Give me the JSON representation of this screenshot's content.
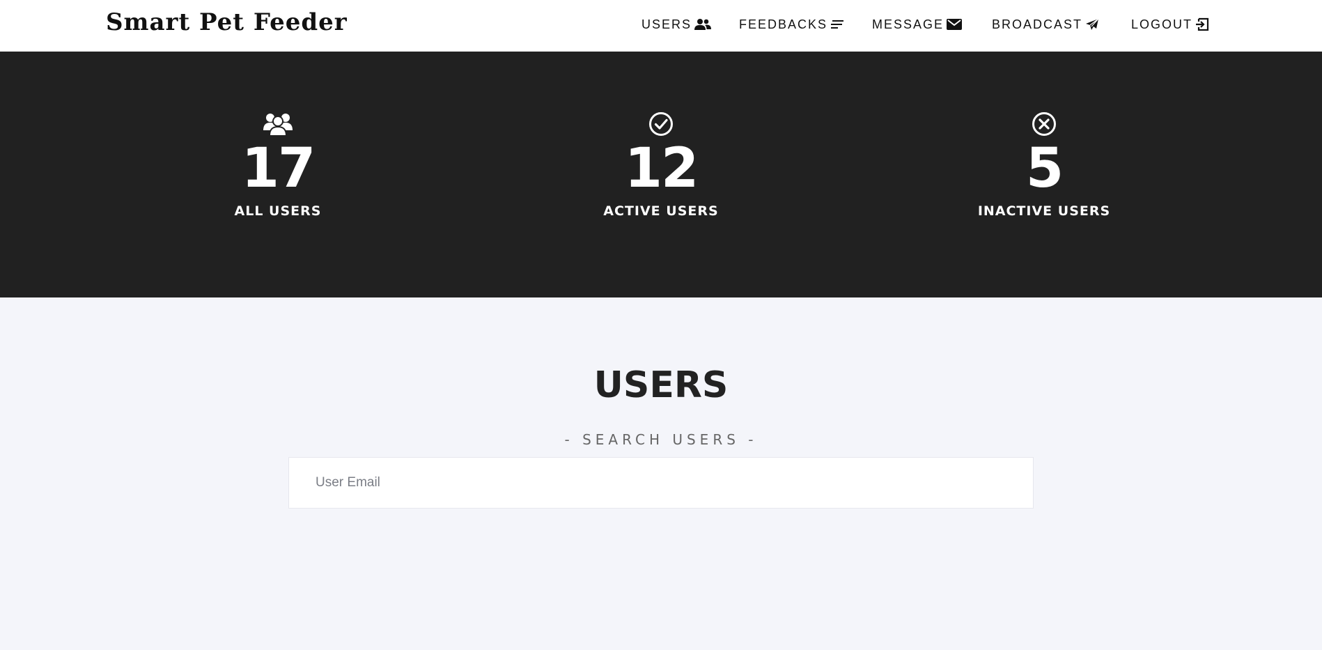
{
  "header": {
    "brand": "Smart Pet Feeder",
    "nav": [
      {
        "label": "USERS",
        "icon": "users-icon"
      },
      {
        "label": "FEEDBACKS",
        "icon": "lines-icon"
      },
      {
        "label": "MESSAGE",
        "icon": "envelope-icon"
      },
      {
        "label": "BROADCAST",
        "icon": "paper-plane-icon"
      },
      {
        "label": "LOGOUT",
        "icon": "logout-icon"
      }
    ]
  },
  "stats": [
    {
      "value": "17",
      "label": "ALL USERS",
      "icon": "users-group-icon"
    },
    {
      "value": "12",
      "label": "ACTIVE USERS",
      "icon": "check-circle-icon"
    },
    {
      "value": "5",
      "label": "INACTIVE USERS",
      "icon": "x-circle-icon"
    }
  ],
  "users_section": {
    "title": "USERS",
    "subtitle": "- SEARCH USERS -",
    "search_placeholder": "User Email",
    "search_value": ""
  },
  "colors": {
    "header_bg": "#ffffff",
    "stats_bg": "#212121",
    "page_bg": "#f4f5fa",
    "text_dark": "#222222"
  }
}
